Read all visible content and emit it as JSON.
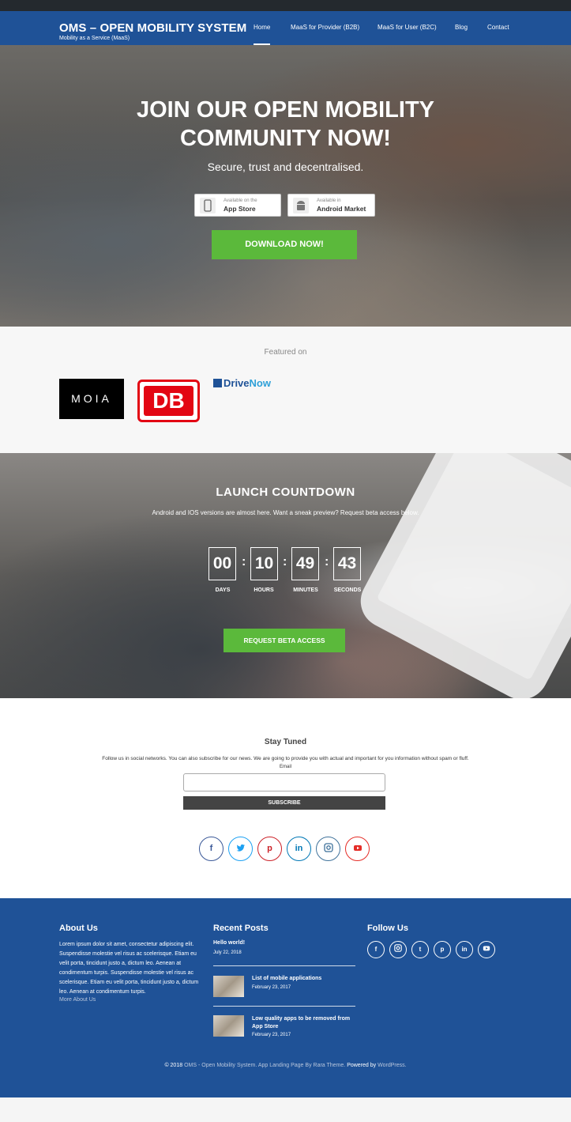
{
  "header": {
    "title": "OMS – OPEN MOBILITY SYSTEM",
    "subtitle": "Mobility as a Service (MaaS)",
    "nav": [
      "Home",
      "MaaS for Provider (B2B)",
      "MaaS for User (B2C)",
      "Blog",
      "Contact"
    ],
    "active_nav": "Home"
  },
  "hero": {
    "title_line1": "JOIN OUR OPEN MOBILITY",
    "title_line2": "COMMUNITY NOW!",
    "subtitle": "Secure, trust and decentralised.",
    "appstore": {
      "small": "Available on the",
      "big": "App Store"
    },
    "android": {
      "small": "Available in",
      "big": "Android Market"
    },
    "download_label": "DOWNLOAD NOW!"
  },
  "featured": {
    "title": "Featured on",
    "logos": {
      "moia": "MOIA",
      "db": "DB",
      "drivenow_a": "Drive",
      "drivenow_b": "Now"
    }
  },
  "countdown": {
    "title": "LAUNCH COUNTDOWN",
    "subtitle": "Android and IOS versions are almost here. Want a sneak preview? Request beta access below.",
    "days": "00",
    "hours": "10",
    "minutes": "49",
    "seconds": "43",
    "labels": [
      "DAYS",
      "HOURS",
      "MINUTES",
      "SECONDS"
    ],
    "button": "REQUEST BETA ACCESS"
  },
  "stay_tuned": {
    "title": "Stay Tuned",
    "text": "Follow us in social networks. You can also subscribe for our news. We are going to provide you with actual and important for you information without spam or fluff.",
    "email_label": "Email",
    "email_value": "",
    "subscribe": "SUBSCRIBE",
    "socials": [
      "facebook-icon",
      "twitter-icon",
      "pinterest-icon",
      "linkedin-icon",
      "instagram-icon",
      "youtube-icon"
    ]
  },
  "footer": {
    "about_title": "About Us",
    "about_text": "Lorem ipsum dolor sit amet, consectetur adipiscing elit. Suspendisse molestie vel risus ac scelerisque. Etiam eu velit porta, tincidunt justo a, dictum leo. Aenean at condimentum turpis. Suspendisse molestie vel risus ac scelerisque. Etiam eu velit porta, tincidunt justo a, dictum leo. Aenean at condimentum turpis.",
    "about_more": "More About Us",
    "posts_title": "Recent Posts",
    "posts": [
      {
        "title": "Hello world!",
        "date": "July 22, 2018"
      },
      {
        "title": "List of mobile applications",
        "date": "February 23, 2017"
      },
      {
        "title": "Low quality apps to be removed from App Store",
        "date": "February 23, 2017"
      }
    ],
    "follow_title": "Follow Us",
    "copyright_prefix": "© 2018",
    "copyright_site": "OMS - Open Mobility System.",
    "copyright_theme": "App Landing Page By Rara Theme.",
    "copyright_powered": "Powered by",
    "copyright_wp": "WordPress."
  }
}
